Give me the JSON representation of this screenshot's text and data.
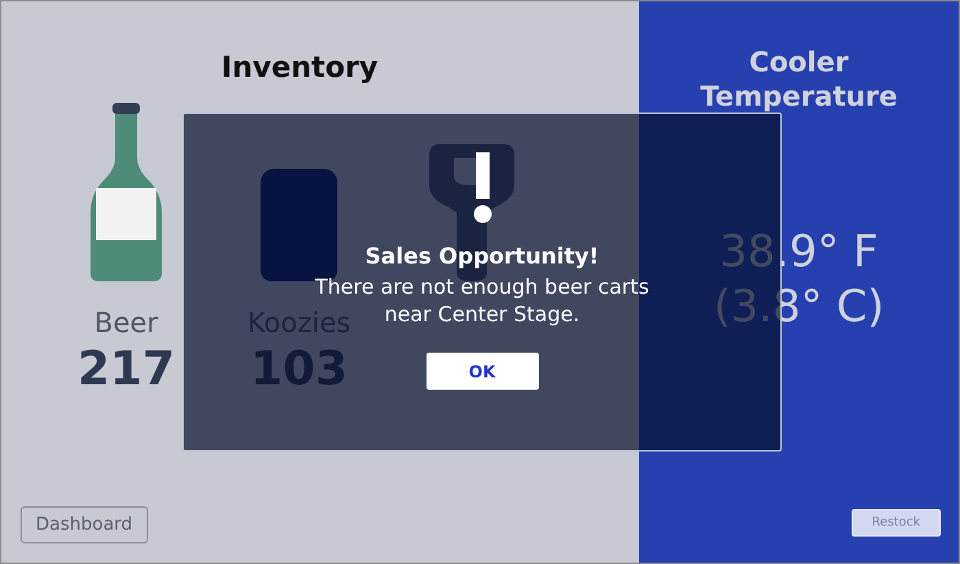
{
  "inventory": {
    "title": "Inventory",
    "items": [
      {
        "kind": "bottle",
        "label": "Beer",
        "count": "217"
      },
      {
        "kind": "koozie",
        "label": "Koozies",
        "count": "103"
      },
      {
        "kind": "opener"
      }
    ]
  },
  "dashboard_button": "Dashboard",
  "cooler": {
    "title": "Cooler Temperature",
    "fahrenheit": "38.9° F",
    "celsius": "(3.8° C)",
    "restock_button": "Restock",
    "restock_disabled": true
  },
  "dialog": {
    "title": "Sales Opportunity!",
    "message_lines": [
      "There are not enough beer carts",
      "near Center Stage."
    ],
    "ok_button": "OK"
  }
}
